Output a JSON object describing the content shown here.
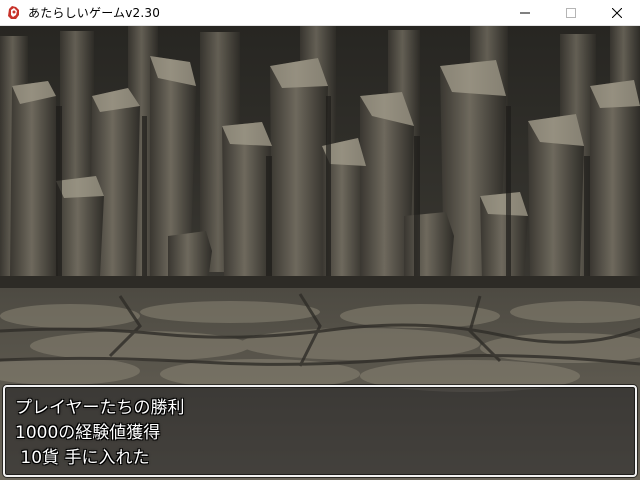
{
  "window": {
    "title": "あたらしいゲームv2.30",
    "app_icon": "rpg-maker-icon",
    "controls": [
      "minimize-icon",
      "maximize-icon",
      "close-icon"
    ]
  },
  "scene": {
    "background": "rocky-cliff-wall-over-stone-floor",
    "palette": {
      "sky_dark": "#2b2a26",
      "rock_light": "#9a9484",
      "rock_mid": "#5f5a4f",
      "rock_dark": "#3a3731",
      "floor": "#6f6a5e"
    }
  },
  "battle_result": {
    "lines": [
      "プレイヤーたちの勝利",
      "1000の経験値獲得",
      " 10貨 手に入れた"
    ]
  }
}
